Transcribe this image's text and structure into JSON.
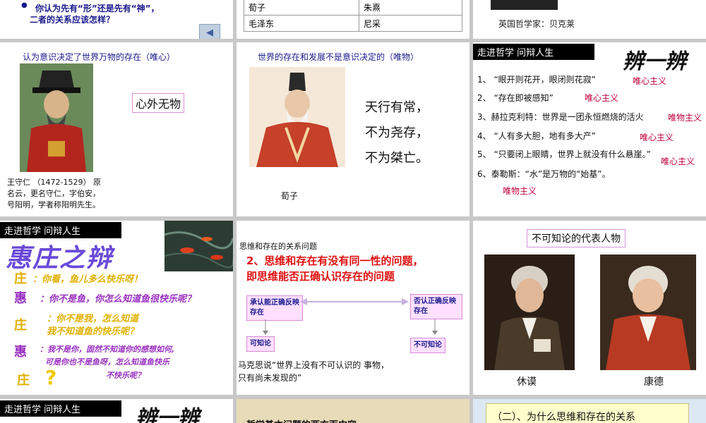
{
  "tile_top_left": {
    "bullet": "●",
    "question_line1": "你认为先有“形”还是先有“神”，",
    "question_line2": "二者的关系应该怎样？",
    "back_arrow": "◀"
  },
  "tile_top_mid": {
    "table": [
      [
        "荀子",
        "朱熹"
      ],
      [
        "毛泽东",
        "尼采"
      ]
    ]
  },
  "tile_top_right": {
    "caption": "英国哲学家：贝克莱"
  },
  "tile_idealism": {
    "heading": "认为意识决定了世界万物的存在（唯心）",
    "boxed_phrase": "心外无物",
    "bio_line1": "王守仁 （1472-1529） 原",
    "bio_line2": "名云，更名守仁，字伯安，",
    "bio_line3": "号阳明，学者称阳明先生。"
  },
  "tile_materialism": {
    "heading": "世界的存在和发展不是意识决定的（唯物）",
    "quote_line1": "天行有常，",
    "quote_line2": "不为尧存，",
    "quote_line3": "不为桀亡。",
    "caption": "荀子"
  },
  "tile_debate": {
    "banner": "走进哲学 问辩人生",
    "stamp": "辨一辨",
    "items": [
      "1、 “眼开则花开，眼闭则花寂”",
      "2、 “存在即被感知”",
      "3、赫拉克利特：世界是一团永恒燃烧的活火",
      "4、 “人有多大胆，地有多大产”",
      "5、 “只要闭上眼睛，世界上就没有什么悬崖。”",
      "6、泰勒斯：“水”是万物的“始基”。"
    ],
    "labels": [
      "唯心主义",
      "唯心主义",
      "唯物主义",
      "唯心主义",
      "唯心主义",
      "唯物主义"
    ]
  },
  "tile_fish": {
    "banner": "走进哲学 问辩人生",
    "title": "惠庄之辩",
    "line1_speaker": "庄",
    "line1_text": "：你看，鱼儿多么快乐呀！",
    "line2_speaker": "惠",
    "line2_text": "：你不是鱼，你怎么知道鱼很快乐呢？",
    "line3_speaker": "庄",
    "line3_text_a": "：你不是我，怎么知道",
    "line3_text_b": "我不知道鱼的快乐呢？",
    "line4_speaker": "惠",
    "line4_text_a": "：我不是你，固然不知道你的感想如何,",
    "line4_text_b": "可是你也不是鱼呀，怎么知道鱼快乐",
    "line4_text_c": "不快乐呢？",
    "line5_speaker": "庄",
    "question_mark": "?"
  },
  "tile_identity": {
    "small_heading": "思维和存在的关系问题",
    "title_line1": "2、思维和存在有没有同一性的问题，",
    "title_line2": "即思维能否正确认识存在的问题",
    "left_box": "承认能正确反映存在",
    "right_box": "否认正确反映存在",
    "left_result": "可知论",
    "right_result": "不可知论",
    "quote_line1": "马克思说“世界上没有不可认识的 事物，",
    "quote_line2": "只有尚未发现的”"
  },
  "tile_agnostic": {
    "title": "不可知论的代表人物",
    "left_name": "休谟",
    "right_name": "康德"
  },
  "tile_bottom_left": {
    "banner": "走进哲学 问辩人生",
    "stamp": "辨一辨"
  },
  "tile_bottom_mid": {
    "partial_text": "哲学基本问题的两方面内容"
  },
  "tile_bottom_right": {
    "partial_text": "（二）、为什么思维和存在的关系"
  }
}
